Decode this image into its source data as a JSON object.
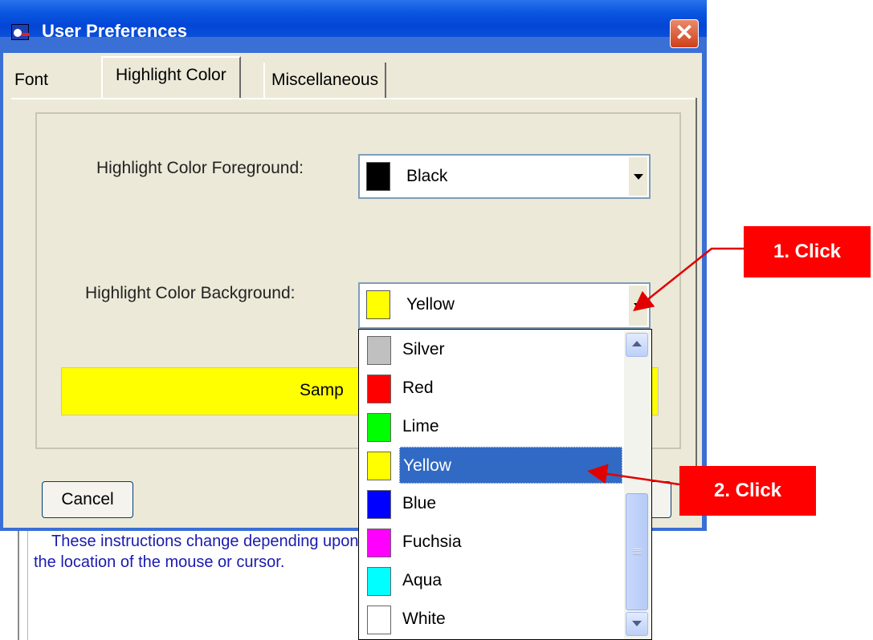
{
  "window": {
    "title": "User Preferences",
    "close_symbol": "✕"
  },
  "tabs": [
    {
      "label": "Font",
      "active": false
    },
    {
      "label": "Highlight Color",
      "active": true
    },
    {
      "label": "Miscellaneous",
      "active": false
    }
  ],
  "foreground": {
    "label": "Highlight Color Foreground:",
    "value": "Black",
    "swatch_color": "#000000"
  },
  "background": {
    "label": "Highlight Color Background:",
    "value": "Yellow",
    "swatch_color": "#ffff00"
  },
  "sample": {
    "text": "Samp",
    "color": "#ffff00"
  },
  "buttons": {
    "cancel": "Cancel"
  },
  "dropdown": {
    "selected_index": 3,
    "items": [
      {
        "label": "Silver",
        "color": "#c0c0c0"
      },
      {
        "label": "Red",
        "color": "#ff0000"
      },
      {
        "label": "Lime",
        "color": "#00ff00"
      },
      {
        "label": "Yellow",
        "color": "#ffff00"
      },
      {
        "label": "Blue",
        "color": "#0000ff"
      },
      {
        "label": "Fuchsia",
        "color": "#ff00ff"
      },
      {
        "label": "Aqua",
        "color": "#00ffff"
      },
      {
        "label": "White",
        "color": "#ffffff"
      }
    ]
  },
  "help_text": "These instructions change depending upon the location of the mouse or cursor.",
  "annotations": {
    "step1": "1. Click",
    "step2": "2. Click",
    "color": "#ff0000"
  }
}
